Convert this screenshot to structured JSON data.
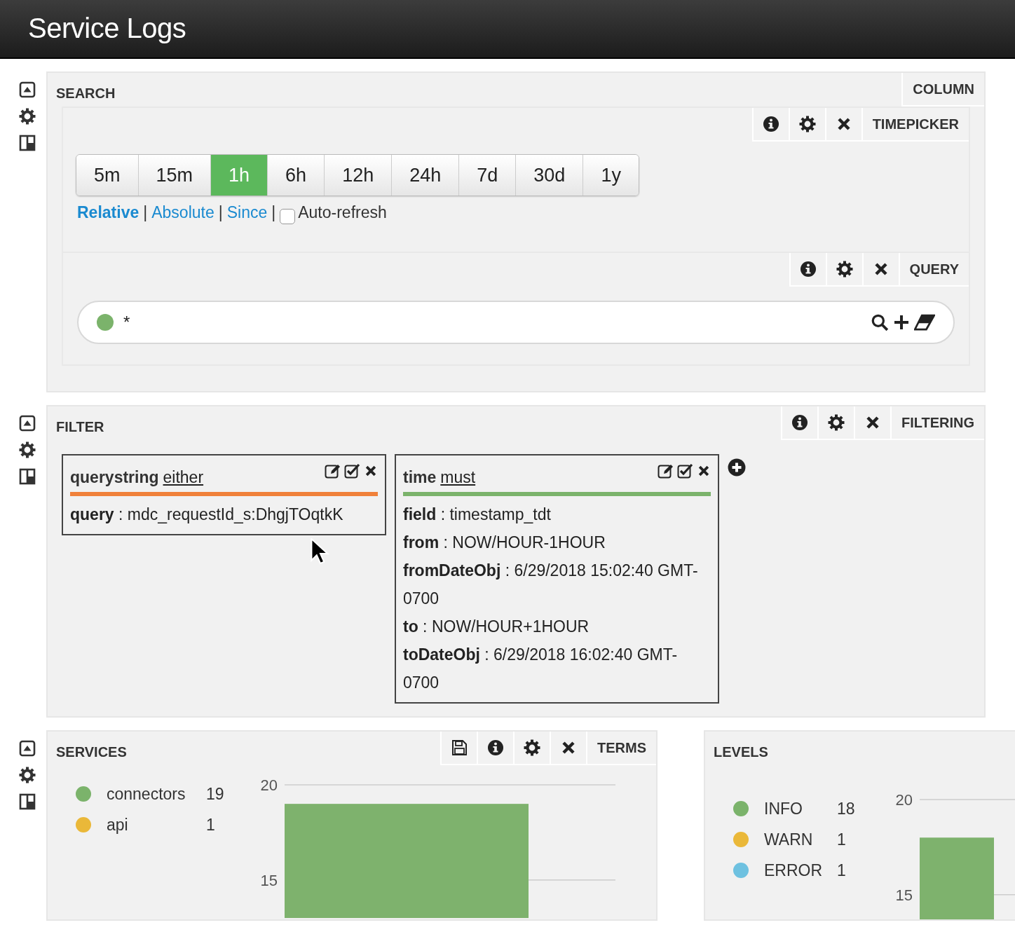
{
  "header": {
    "title": "Service Logs"
  },
  "search": {
    "title": "SEARCH",
    "tab": "COLUMN",
    "timepicker": {
      "tab": "TIMEPICKER",
      "ranges": [
        {
          "label": "5m",
          "selected": false
        },
        {
          "label": "15m",
          "selected": false
        },
        {
          "label": "1h",
          "selected": true
        },
        {
          "label": "6h",
          "selected": false
        },
        {
          "label": "12h",
          "selected": false
        },
        {
          "label": "24h",
          "selected": false
        },
        {
          "label": "7d",
          "selected": false
        },
        {
          "label": "30d",
          "selected": false
        },
        {
          "label": "1y",
          "selected": false
        }
      ],
      "modes": [
        {
          "label": "Relative",
          "selected": true
        },
        {
          "label": "Absolute",
          "selected": false
        },
        {
          "label": "Since",
          "selected": false
        }
      ],
      "separator": "|",
      "auto_refresh": {
        "label": "Auto-refresh",
        "checked": false
      }
    },
    "query": {
      "tab": "QUERY",
      "value": "*",
      "color": "#7bb36b"
    }
  },
  "filter": {
    "title": "FILTER",
    "tab": "FILTERING",
    "filters": [
      {
        "type": "querystring",
        "mandate": "either",
        "color": "#f0813a",
        "fields": [
          "**query** : mdc_requestId_s:DhgjTOqtkK"
        ]
      },
      {
        "type": "time",
        "mandate": "must",
        "color": "#7bb36b",
        "fields": [
          "**field** : timestamp_tdt",
          "**from** : NOW/HOUR-1HOUR",
          "**fromDateObj** : 6/29/2018 15:02:40 GMT-0700",
          "**to** : NOW/HOUR+1HOUR",
          "**toDateObj** : 6/29/2018 16:02:40 GMT-0700"
        ]
      }
    ]
  },
  "services": {
    "title": "SERVICES",
    "tab": "TERMS",
    "legend": [
      {
        "label": "connectors",
        "count": "19",
        "color": "#7bb36b"
      },
      {
        "label": "api",
        "count": "1",
        "color": "#eab839"
      }
    ],
    "chart_data": {
      "type": "bar",
      "values": [
        19
      ],
      "yticks": [
        15,
        20
      ],
      "ylim": [
        13,
        20
      ]
    }
  },
  "levels": {
    "title": "LEVELS",
    "legend": [
      {
        "label": "INFO",
        "count": "18",
        "color": "#7bb36b"
      },
      {
        "label": "WARN",
        "count": "1",
        "color": "#eab839"
      },
      {
        "label": "ERROR",
        "count": "1",
        "color": "#6ec1e0"
      }
    ],
    "chart_data": {
      "type": "bar",
      "values": [
        18
      ],
      "yticks": [
        15,
        20
      ],
      "ylim": [
        13,
        20
      ]
    }
  }
}
